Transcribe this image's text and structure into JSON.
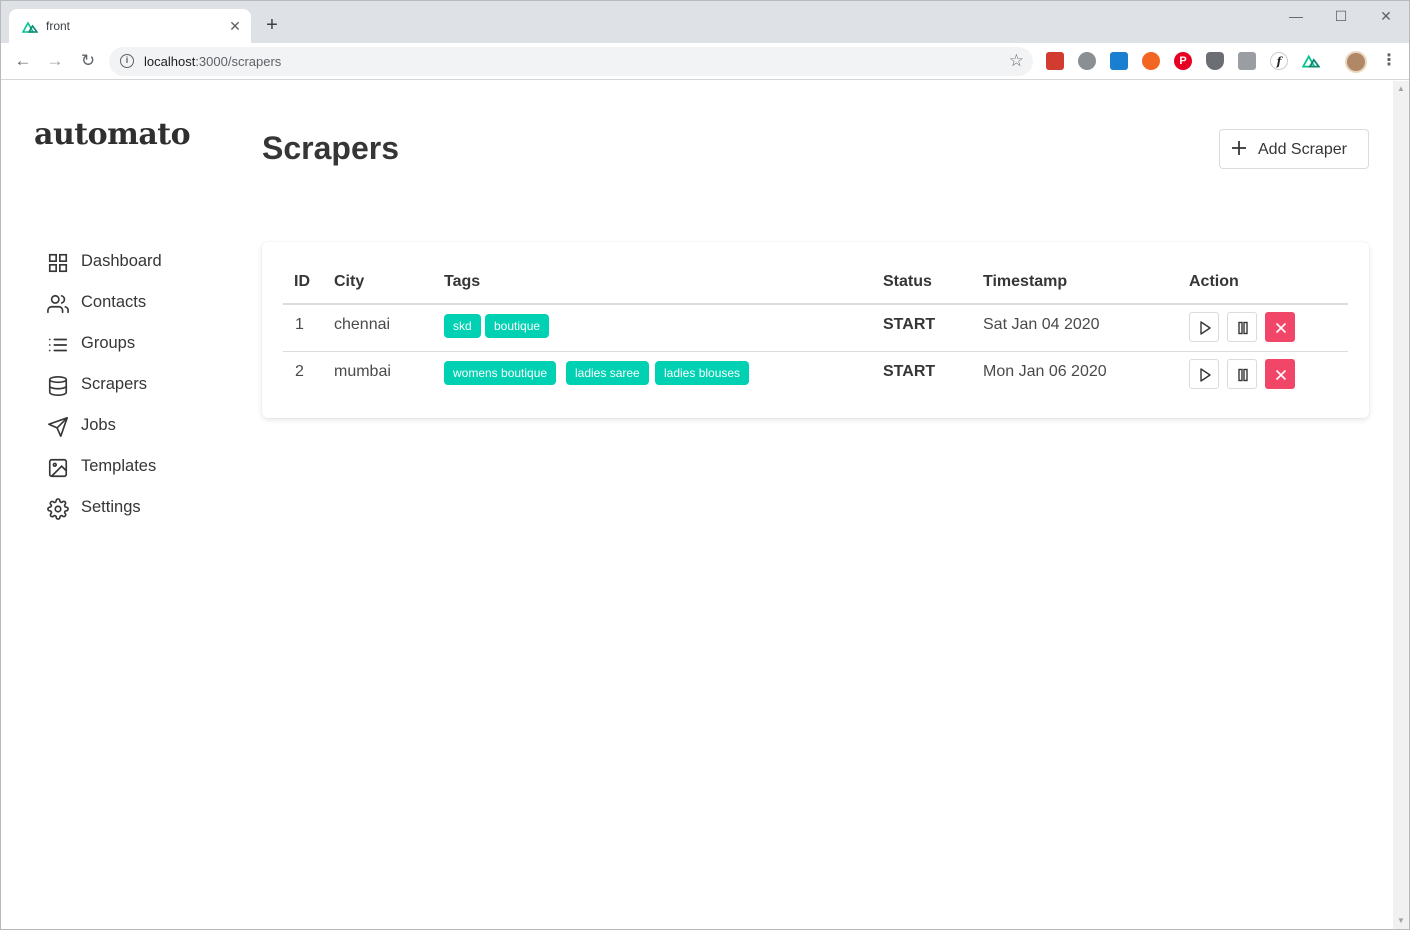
{
  "browser": {
    "tab_title": "front",
    "url_host": "localhost",
    "url_path": ":3000/scrapers",
    "close_glyph": "✕",
    "newtab_glyph": "+"
  },
  "app": {
    "logo": "automato"
  },
  "sidebar": {
    "items": [
      {
        "label": "Dashboard",
        "icon": "grid-icon"
      },
      {
        "label": "Contacts",
        "icon": "users-icon"
      },
      {
        "label": "Groups",
        "icon": "list-icon"
      },
      {
        "label": "Scrapers",
        "icon": "database-icon"
      },
      {
        "label": "Jobs",
        "icon": "send-icon"
      },
      {
        "label": "Templates",
        "icon": "image-icon"
      },
      {
        "label": "Settings",
        "icon": "gear-icon"
      }
    ]
  },
  "header": {
    "title": "Scrapers",
    "add_button": "Add Scraper"
  },
  "table": {
    "columns": [
      "ID",
      "City",
      "Tags",
      "Status",
      "Timestamp",
      "Action"
    ],
    "rows": [
      {
        "id": "1",
        "city": "chennai",
        "tags": [
          "skd",
          "boutique"
        ],
        "status": "START",
        "timestamp": "Sat Jan 04 2020"
      },
      {
        "id": "2",
        "city": "mumbai",
        "tags": [
          "womens boutique",
          "ladies saree",
          "ladies blouses"
        ],
        "status": "START",
        "timestamp": "Mon Jan 06 2020"
      }
    ]
  },
  "colors": {
    "tag": "#00d1b2",
    "danger": "#f14668",
    "text": "#363636"
  }
}
